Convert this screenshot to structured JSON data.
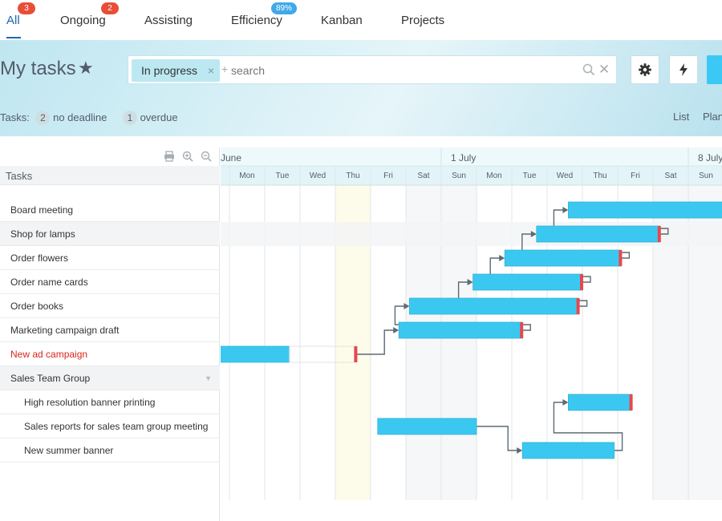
{
  "tabs": [
    {
      "label": "All",
      "badge": "3",
      "active": true
    },
    {
      "label": "Ongoing",
      "badge": "2"
    },
    {
      "label": "Assisting"
    },
    {
      "label": "Efficiency",
      "badge": "89%"
    },
    {
      "label": "Kanban"
    },
    {
      "label": "Projects"
    }
  ],
  "header": {
    "title": "My tasks",
    "filter_chip": "In progress",
    "search_plus": "+",
    "search_placeholder": "search",
    "counters_label": "Tasks:",
    "no_deadline_count": "2",
    "no_deadline_label": "no deadline",
    "overdue_count": "1",
    "overdue_label": "overdue",
    "views": [
      "List",
      "Plan"
    ]
  },
  "grid": {
    "header": "Tasks",
    "rows": [
      {
        "label": "Board meeting"
      },
      {
        "label": "Shop for lamps"
      },
      {
        "label": "Order flowers"
      },
      {
        "label": "Order name cards"
      },
      {
        "label": "Order books"
      },
      {
        "label": "Marketing campaign draft"
      },
      {
        "label": "New ad campaign",
        "overdue": true
      },
      {
        "label": "Sales Team Group",
        "group": true
      },
      {
        "label": "High resolution banner printing",
        "child": true
      },
      {
        "label": "Sales reports for sales team group meeting",
        "child": true
      },
      {
        "label": "New summer banner",
        "child": true
      }
    ]
  },
  "gantt": {
    "months": [
      {
        "label": "June",
        "day": 0
      },
      {
        "label": "1 July",
        "day": 6
      },
      {
        "label": "8 July",
        "day": 13
      }
    ],
    "days": [
      "Mon",
      "Tue",
      "Wed",
      "Thu",
      "Fri",
      "Sat",
      "Sun",
      "Mon",
      "Tue",
      "Wed",
      "Thu",
      "Fri",
      "Sat",
      "Sun"
    ],
    "today_index": 3,
    "weekend_indices": [
      5,
      6,
      12,
      13
    ],
    "bars": [
      {
        "row": 0,
        "start": 9.6,
        "end": 14.6,
        "deadline": null
      },
      {
        "row": 1,
        "start": 8.7,
        "end": 12.2,
        "deadline": 12.2
      },
      {
        "row": 2,
        "start": 7.8,
        "end": 11.1,
        "deadline": 11.1
      },
      {
        "row": 3,
        "start": 6.9,
        "end": 10.0,
        "deadline": 10.0
      },
      {
        "row": 4,
        "start": 5.1,
        "end": 9.9,
        "deadline": 9.9
      },
      {
        "row": 5,
        "start": 4.8,
        "end": 8.3,
        "deadline": 8.3
      },
      {
        "row": 6,
        "start": -0.3,
        "end": 1.7,
        "deadline": 3.6
      },
      {
        "row": 8,
        "start": 9.6,
        "end": 11.4,
        "deadline": 11.4
      },
      {
        "row": 9,
        "start": 4.2,
        "end": 7.0,
        "deadline": null
      },
      {
        "row": 10,
        "start": 8.3,
        "end": 10.9,
        "deadline": null
      }
    ],
    "links": [
      {
        "from": 6,
        "to": 5
      },
      {
        "from": 5,
        "to": 4
      },
      {
        "from": 4,
        "to": 3
      },
      {
        "from": 3,
        "to": 2
      },
      {
        "from": 2,
        "to": 1
      },
      {
        "from": 1,
        "to": 0
      },
      {
        "from": 9,
        "to": 10
      },
      {
        "from": 10,
        "to": 8
      }
    ],
    "colors": {
      "bar": "#3bc8f0",
      "bar_border": "#2fb1d9",
      "deadline": "#e8474e",
      "link": "#5d6a73",
      "today": "#fdfbea",
      "weekend": "#f5f7f8"
    }
  }
}
